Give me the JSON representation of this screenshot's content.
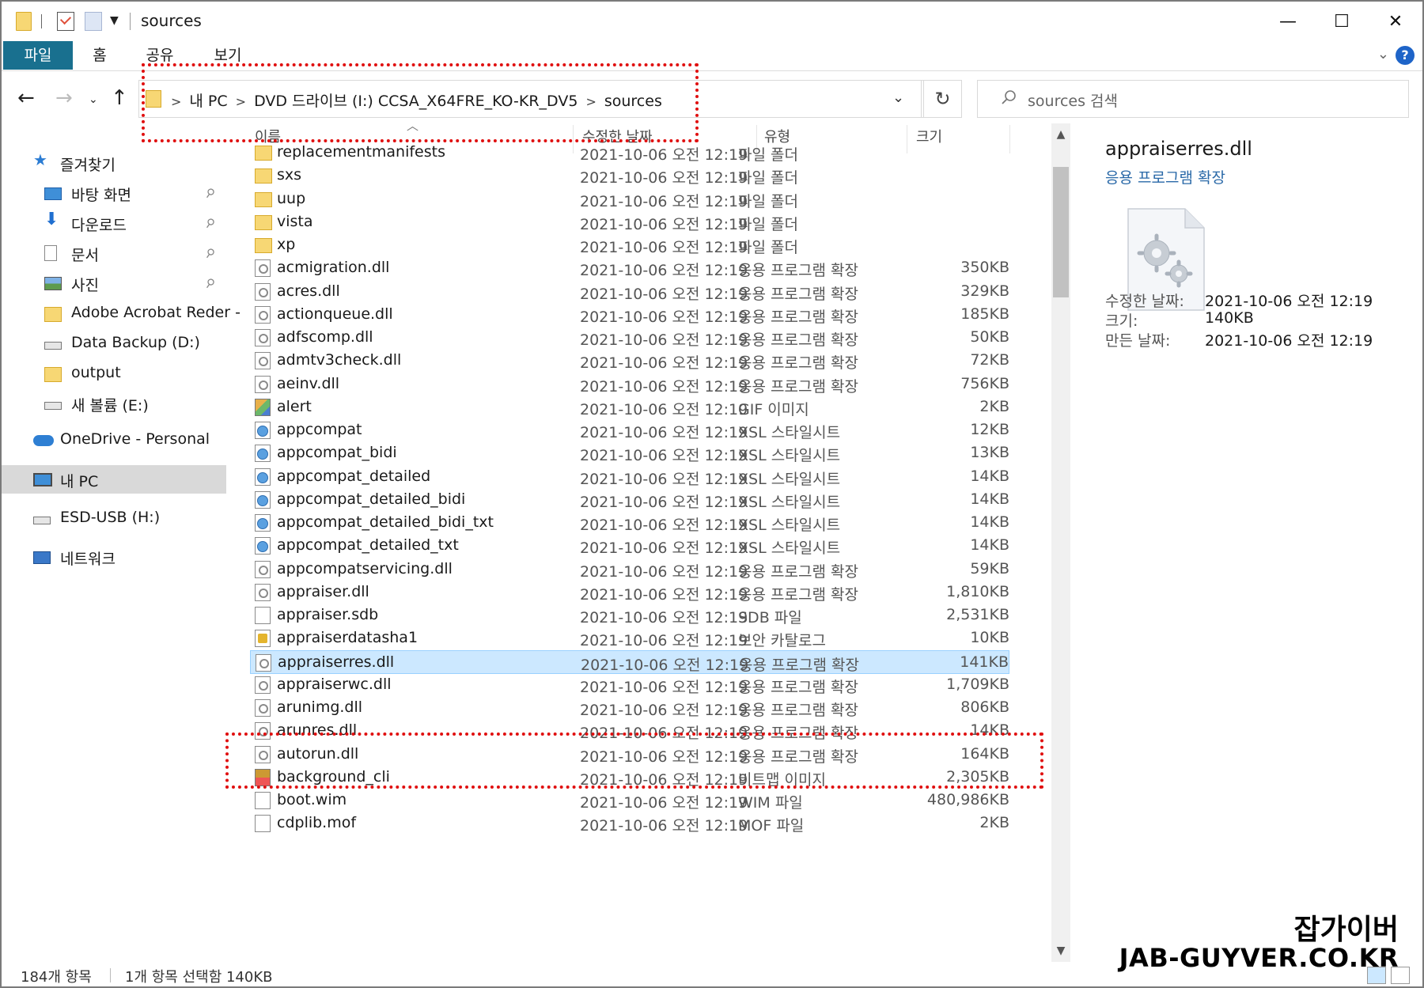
{
  "window": {
    "title": "sources",
    "minimize_glyph": "—",
    "maximize_glyph": "☐",
    "close_glyph": "✕"
  },
  "ribbon": {
    "tabs": [
      "파일",
      "홈",
      "공유",
      "보기"
    ],
    "help_glyph": "?"
  },
  "address": {
    "crumbs": [
      "내 PC",
      "DVD 드라이브 (I:) CCSA_X64FRE_KO-KR_DV5",
      "sources"
    ],
    "search_placeholder": "sources 검색"
  },
  "nav": {
    "items": [
      {
        "label": "즐겨찾기",
        "icon": "star-icon"
      },
      {
        "label": "바탕 화면",
        "icon": "desktop-icon",
        "pinned": true
      },
      {
        "label": "다운로드",
        "icon": "download-icon",
        "pinned": true
      },
      {
        "label": "문서",
        "icon": "document-icon",
        "pinned": true
      },
      {
        "label": "사진",
        "icon": "picture-icon",
        "pinned": true
      },
      {
        "label": "Adobe Acrobat Reder -",
        "icon": "folder-icon"
      },
      {
        "label": "Data Backup (D:)",
        "icon": "drive-icon"
      },
      {
        "label": "output",
        "icon": "folder-icon"
      },
      {
        "label": "새 볼륨 (E:)",
        "icon": "drive-icon"
      },
      {
        "label": "OneDrive - Personal",
        "icon": "cloud-icon"
      },
      {
        "label": "내 PC",
        "icon": "computer-icon",
        "selected": true
      },
      {
        "label": "ESD-USB (H:)",
        "icon": "usb-drive-icon"
      },
      {
        "label": "네트워크",
        "icon": "network-icon"
      }
    ],
    "pin_glyph": "📌"
  },
  "columns": {
    "name": "이름",
    "date": "수정한 날짜",
    "type": "유형",
    "size": "크기"
  },
  "files": [
    {
      "name": "replacementmanifests",
      "date": "2021-10-06 오전 12:19",
      "type": "파일 폴더",
      "size": "",
      "icon": "folder"
    },
    {
      "name": "sxs",
      "date": "2021-10-06 오전 12:19",
      "type": "파일 폴더",
      "size": "",
      "icon": "folder"
    },
    {
      "name": "uup",
      "date": "2021-10-06 오전 12:19",
      "type": "파일 폴더",
      "size": "",
      "icon": "folder"
    },
    {
      "name": "vista",
      "date": "2021-10-06 오전 12:19",
      "type": "파일 폴더",
      "size": "",
      "icon": "folder"
    },
    {
      "name": "xp",
      "date": "2021-10-06 오전 12:19",
      "type": "파일 폴더",
      "size": "",
      "icon": "folder"
    },
    {
      "name": "acmigration.dll",
      "date": "2021-10-06 오전 12:19",
      "type": "응용 프로그램 확장",
      "size": "350KB",
      "icon": "dll"
    },
    {
      "name": "acres.dll",
      "date": "2021-10-06 오전 12:19",
      "type": "응용 프로그램 확장",
      "size": "329KB",
      "icon": "dll"
    },
    {
      "name": "actionqueue.dll",
      "date": "2021-10-06 오전 12:19",
      "type": "응용 프로그램 확장",
      "size": "185KB",
      "icon": "dll"
    },
    {
      "name": "adfscomp.dll",
      "date": "2021-10-06 오전 12:19",
      "type": "응용 프로그램 확장",
      "size": "50KB",
      "icon": "dll"
    },
    {
      "name": "admtv3check.dll",
      "date": "2021-10-06 오전 12:19",
      "type": "응용 프로그램 확장",
      "size": "72KB",
      "icon": "dll"
    },
    {
      "name": "aeinv.dll",
      "date": "2021-10-06 오전 12:19",
      "type": "응용 프로그램 확장",
      "size": "756KB",
      "icon": "dll"
    },
    {
      "name": "alert",
      "date": "2021-10-06 오전 12:19",
      "type": "GIF 이미지",
      "size": "2KB",
      "icon": "gif"
    },
    {
      "name": "appcompat",
      "date": "2021-10-06 오전 12:19",
      "type": "XSL 스타일시트",
      "size": "12KB",
      "icon": "xsl"
    },
    {
      "name": "appcompat_bidi",
      "date": "2021-10-06 오전 12:19",
      "type": "XSL 스타일시트",
      "size": "13KB",
      "icon": "xsl"
    },
    {
      "name": "appcompat_detailed",
      "date": "2021-10-06 오전 12:19",
      "type": "XSL 스타일시트",
      "size": "14KB",
      "icon": "xsl"
    },
    {
      "name": "appcompat_detailed_bidi",
      "date": "2021-10-06 오전 12:19",
      "type": "XSL 스타일시트",
      "size": "14KB",
      "icon": "xsl"
    },
    {
      "name": "appcompat_detailed_bidi_txt",
      "date": "2021-10-06 오전 12:19",
      "type": "XSL 스타일시트",
      "size": "14KB",
      "icon": "xsl"
    },
    {
      "name": "appcompat_detailed_txt",
      "date": "2021-10-06 오전 12:19",
      "type": "XSL 스타일시트",
      "size": "14KB",
      "icon": "xsl"
    },
    {
      "name": "appcompatservicing.dll",
      "date": "2021-10-06 오전 12:19",
      "type": "응용 프로그램 확장",
      "size": "59KB",
      "icon": "dll"
    },
    {
      "name": "appraiser.dll",
      "date": "2021-10-06 오전 12:19",
      "type": "응용 프로그램 확장",
      "size": "1,810KB",
      "icon": "dll"
    },
    {
      "name": "appraiser.sdb",
      "date": "2021-10-06 오전 12:19",
      "type": "SDB 파일",
      "size": "2,531KB",
      "icon": "file"
    },
    {
      "name": "appraiserdatasha1",
      "date": "2021-10-06 오전 12:19",
      "type": "보안 카탈로그",
      "size": "10KB",
      "icon": "cat"
    },
    {
      "name": "appraiserres.dll",
      "date": "2021-10-06 오전 12:19",
      "type": "응용 프로그램 확장",
      "size": "141KB",
      "icon": "dll",
      "selected": true
    },
    {
      "name": "appraiserwc.dll",
      "date": "2021-10-06 오전 12:19",
      "type": "응용 프로그램 확장",
      "size": "1,709KB",
      "icon": "dll"
    },
    {
      "name": "arunimg.dll",
      "date": "2021-10-06 오전 12:19",
      "type": "응용 프로그램 확장",
      "size": "806KB",
      "icon": "dll"
    },
    {
      "name": "arunres.dll",
      "date": "2021-10-06 오전 12:19",
      "type": "응용 프로그램 확장",
      "size": "14KB",
      "icon": "dll"
    },
    {
      "name": "autorun.dll",
      "date": "2021-10-06 오전 12:19",
      "type": "응용 프로그램 확장",
      "size": "164KB",
      "icon": "dll"
    },
    {
      "name": "background_cli",
      "date": "2021-10-06 오전 12:19",
      "type": "비트맵 이미지",
      "size": "2,305KB",
      "icon": "bmp"
    },
    {
      "name": "boot.wim",
      "date": "2021-10-06 오전 12:19",
      "type": "WIM 파일",
      "size": "480,986KB",
      "icon": "file"
    },
    {
      "name": "cdplib.mof",
      "date": "2021-10-06 오전 12:19",
      "type": "MOF 파일",
      "size": "2KB",
      "icon": "file"
    }
  ],
  "preview": {
    "name": "appraiserres.dll",
    "type": "응용 프로그램 확장",
    "modified_label": "수정한 날짜:",
    "modified_value": "2021-10-06 오전 12:19",
    "size_label": "크기:",
    "size_value": "140KB",
    "created_label": "만든 날짜:",
    "created_value": "2021-10-06 오전 12:19"
  },
  "status": {
    "count": "184개 항목",
    "selection": "1개 항목 선택함 140KB"
  },
  "watermark": {
    "line1": "잡가이버",
    "line2": "JAB-GUYVER.CO.KR"
  },
  "colors": {
    "highlight": "#e01010",
    "selection": "#cce8ff",
    "file_tab": "#19708f"
  }
}
